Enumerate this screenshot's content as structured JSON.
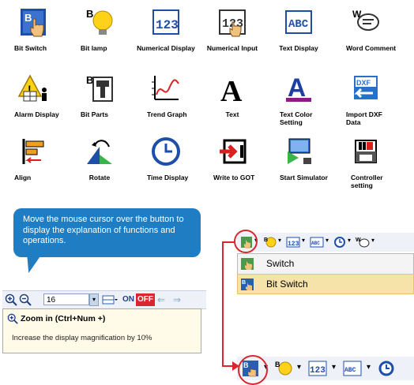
{
  "palette": [
    {
      "label": "Bit Switch",
      "icon": "bit-switch-icon"
    },
    {
      "label": "Bit lamp",
      "icon": "bit-lamp-icon"
    },
    {
      "label": "Numerical Display",
      "icon": "numerical-display-icon"
    },
    {
      "label": "Numerical Input",
      "icon": "numerical-input-icon"
    },
    {
      "label": "Text Display",
      "icon": "text-display-icon"
    },
    {
      "label": "Word Comment",
      "icon": "word-comment-icon"
    },
    {
      "label": "Alarm Display",
      "icon": "alarm-display-icon"
    },
    {
      "label": "Bit Parts",
      "icon": "bit-parts-icon"
    },
    {
      "label": "Trend Graph",
      "icon": "trend-graph-icon"
    },
    {
      "label": "Text",
      "icon": "text-icon"
    },
    {
      "label": "Text Color Setting",
      "icon": "text-color-icon"
    },
    {
      "label": "Import DXF Data",
      "icon": "import-dxf-icon"
    },
    {
      "label": "Align",
      "icon": "align-icon"
    },
    {
      "label": "Rotate",
      "icon": "rotate-icon"
    },
    {
      "label": "Time Display",
      "icon": "time-display-icon"
    },
    {
      "label": "Write to GOT",
      "icon": "write-to-got-icon"
    },
    {
      "label": "Start Simulator",
      "icon": "start-simulator-icon"
    },
    {
      "label": "Controller setting",
      "icon": "controller-setting-icon"
    }
  ],
  "callout": {
    "text": "Move the mouse cursor over the button to display the explanation of functions and operations."
  },
  "left_toolbar": {
    "zoom_value": "16",
    "on_label": "ON",
    "off_label": "OFF"
  },
  "tooltip": {
    "title": "Zoom in (Ctrl+Num +)",
    "description": "Increase the display magnification by 10%"
  },
  "menu": {
    "item1": "Switch",
    "item2": "Bit Switch"
  },
  "colors": {
    "accent_blue": "#1f7dc3",
    "highlight_red": "#d9262f",
    "menu_highlight": "#f6e3a9"
  }
}
